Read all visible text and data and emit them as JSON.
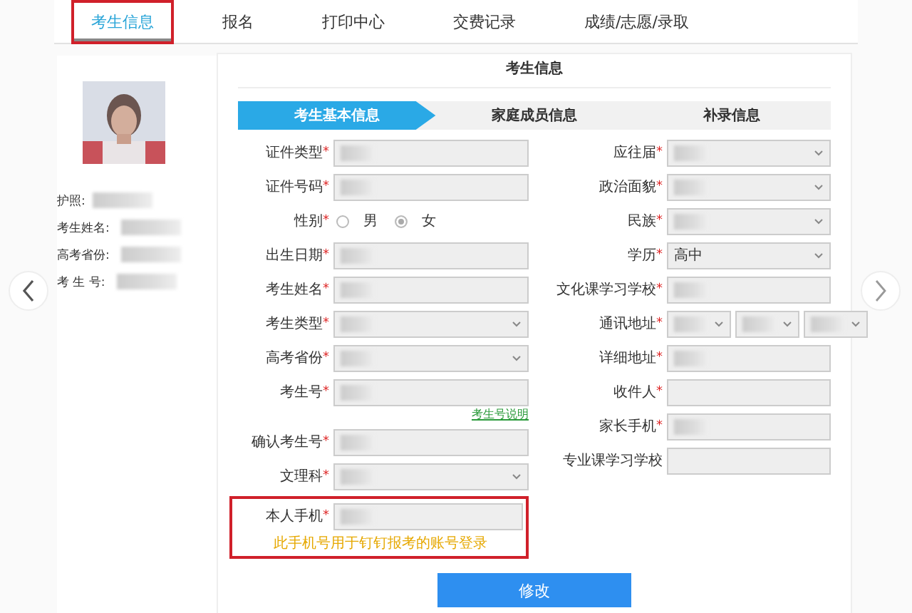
{
  "tabs": [
    {
      "label": "考生信息",
      "selected": true,
      "highlighted": true
    },
    {
      "label": "报名",
      "selected": false,
      "highlighted": false
    },
    {
      "label": "打印中心",
      "selected": false,
      "highlighted": false
    },
    {
      "label": "交费记录",
      "selected": false,
      "highlighted": false
    },
    {
      "label": "成绩/志愿/录取",
      "selected": false,
      "highlighted": false
    }
  ],
  "profile": {
    "fields": [
      {
        "label": "护照:",
        "redacted": true
      },
      {
        "label": "考生姓名:",
        "redacted": true
      },
      {
        "label": "高考省份:",
        "redacted": true
      },
      {
        "label": "考 生 号:",
        "redacted": true
      }
    ]
  },
  "panel": {
    "title": "考生信息",
    "steps": [
      {
        "label": "考生基本信息",
        "selected": true
      },
      {
        "label": "家庭成员信息",
        "selected": false
      },
      {
        "label": "补录信息",
        "selected": false
      }
    ],
    "left_fields": [
      {
        "label": "证件类型",
        "required_mark": "*",
        "kind": "text",
        "redacted": true
      },
      {
        "label": "证件号码",
        "required_mark": "*",
        "kind": "text",
        "redacted": true
      },
      {
        "label": "性别",
        "required_mark": "*",
        "kind": "radio",
        "options": [
          {
            "label": "男",
            "selected": false
          },
          {
            "label": "女",
            "selected": true
          }
        ]
      },
      {
        "label": "出生日期",
        "required_mark": "*",
        "kind": "text",
        "redacted": true
      },
      {
        "label": "考生姓名",
        "required_mark": "*",
        "kind": "text",
        "redacted": true
      },
      {
        "label": "考生类型",
        "required_mark": "*",
        "kind": "select",
        "redacted": true
      },
      {
        "label": "高考省份",
        "required_mark": "*",
        "kind": "select",
        "redacted": true
      },
      {
        "label": "考生号",
        "required_mark": "*",
        "kind": "text",
        "redacted": true,
        "link": "考生号说明"
      },
      {
        "label": "确认考生号",
        "required_mark": "*",
        "kind": "text",
        "redacted": true
      },
      {
        "label": "文理科",
        "required_mark": "*",
        "kind": "select",
        "redacted": true
      },
      {
        "label": "本人手机",
        "required_mark": "*",
        "kind": "text",
        "redacted": true,
        "highlighted": true,
        "note": "此手机号用于钉钉报考的账号登录"
      }
    ],
    "right_fields": [
      {
        "label": "应往届",
        "required_mark": "*",
        "kind": "select",
        "redacted": true
      },
      {
        "label": "政治面貌",
        "required_mark": "*",
        "kind": "select",
        "redacted": true
      },
      {
        "label": "民族",
        "required_mark": "*",
        "kind": "select",
        "redacted": true
      },
      {
        "label": "学历",
        "required_mark": "*",
        "kind": "select",
        "redacted": false,
        "value": "高中"
      },
      {
        "label": "文化课学习学校",
        "required_mark": "*",
        "kind": "text",
        "redacted": true
      },
      {
        "label": "通讯地址",
        "required_mark": "*",
        "kind": "address",
        "parts": [
          {
            "redacted": true
          },
          {
            "redacted": true
          },
          {
            "redacted": true
          }
        ]
      },
      {
        "label": "详细地址",
        "required_mark": "*",
        "kind": "text",
        "redacted": true
      },
      {
        "label": "收件人",
        "required_mark": "*",
        "kind": "text",
        "redacted": false
      },
      {
        "label": "家长手机",
        "required_mark": "*",
        "kind": "text",
        "redacted": true
      },
      {
        "label": "专业课学习学校",
        "kind": "text",
        "redacted": false
      }
    ],
    "submit": "修改"
  }
}
